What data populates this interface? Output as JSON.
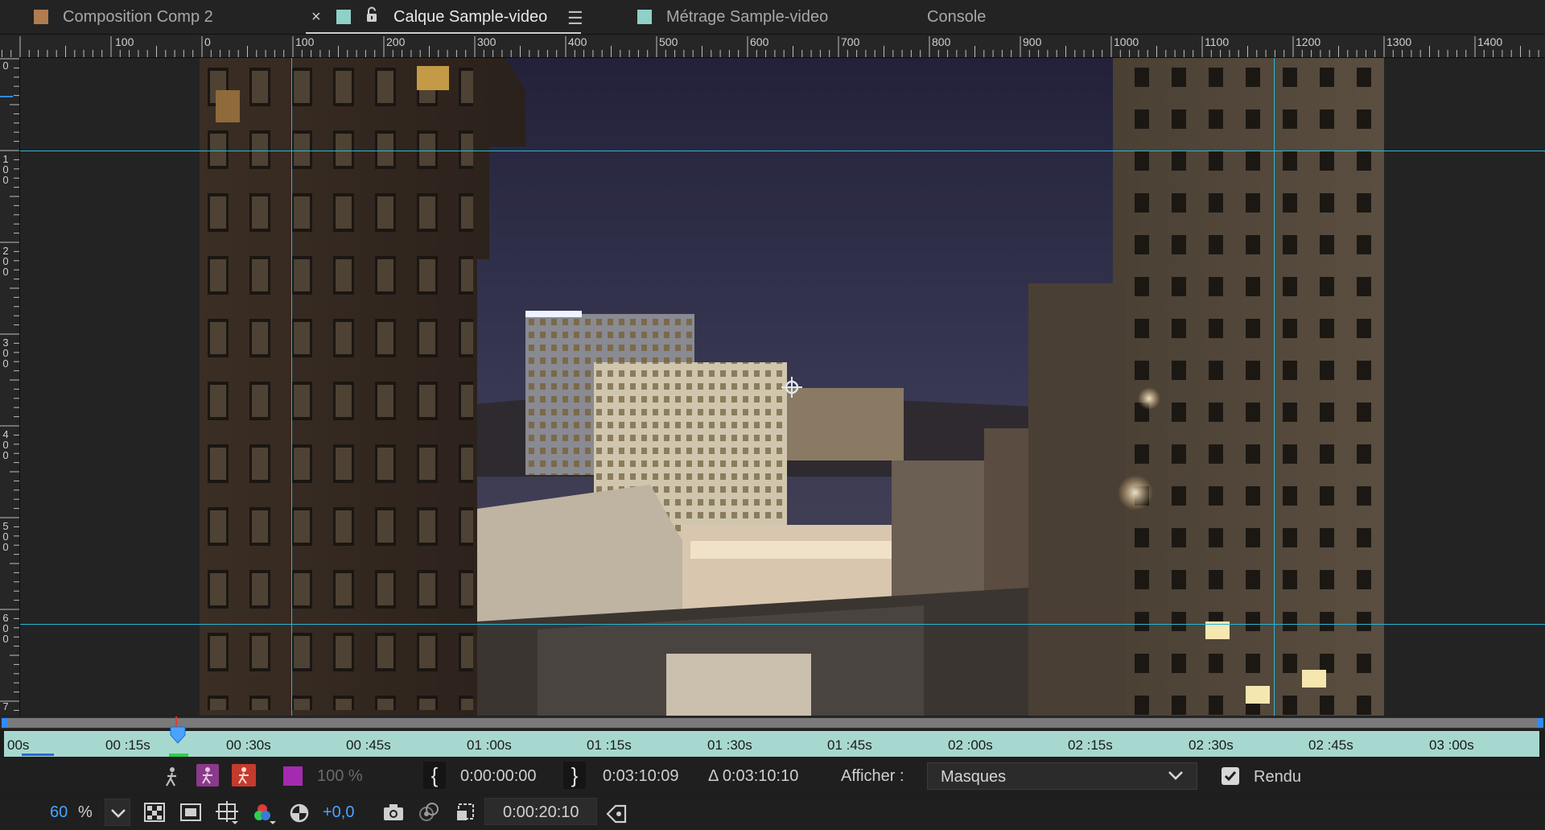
{
  "tabs": [
    {
      "label": "Composition Comp 2",
      "swatch": "#b07c50"
    },
    {
      "label": "Calque Sample-video",
      "swatch": "#8fd0c7"
    },
    {
      "label": "Métrage Sample-video",
      "swatch": "#8fd0c7"
    },
    {
      "label": "Console"
    }
  ],
  "ruler_top": {
    "labels": [
      "100",
      "0",
      "100",
      "200",
      "300",
      "400",
      "500",
      "600",
      "700",
      "800",
      "900",
      "1000",
      "1100",
      "1200",
      "1300",
      "1400"
    ]
  },
  "ruler_left": {
    "labels": [
      "0",
      "100",
      "200",
      "300",
      "400",
      "500",
      "600",
      "7"
    ]
  },
  "timeline": {
    "labels": [
      "00s",
      "00 :15s",
      "00 :30s",
      "00 :45s",
      "01 :00s",
      "01 :15s",
      "01 :30s",
      "01 :45s",
      "02 :00s",
      "02 :15s",
      "02 :30s",
      "02 :45s",
      "03 :00s"
    ]
  },
  "controls": {
    "opacity": "100 %",
    "in_point": "0:00:00:00",
    "out_point": "0:03:10:09",
    "duration": "Δ 0:03:10:10",
    "show_label": "Afficher :",
    "show_value": "Masques",
    "render_label": "Rendu",
    "zoom_value": "60",
    "zoom_unit": "%",
    "exposure": "+0,0",
    "current_time": "0:00:20:10"
  },
  "colors": {
    "guide": "#29b6d6",
    "accent_blue": "#2f8cff",
    "strip": "#a7d8d0"
  }
}
